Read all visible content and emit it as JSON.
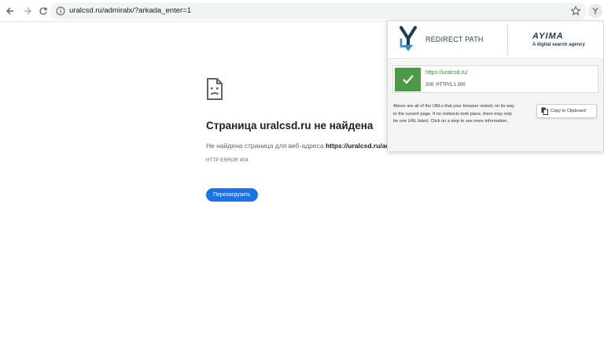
{
  "browser": {
    "url": "uralcsd.ru/admiralx/?arkada_enter=1"
  },
  "error_page": {
    "title": "Страница uralcsd.ru не найдена",
    "description_prefix": "Не найдена страница для веб-адреса ",
    "description_url": "https://uralcsd.ru/adi",
    "error_code": "HTTP ERROR 404",
    "reload_label": "Перезагрузить"
  },
  "popup": {
    "brand_title": "REDIRECT PATH",
    "partner_logo": "AYIMA",
    "partner_tagline": "A digital search agency",
    "result_url": "https://uralcsd.ru/",
    "result_status": "200: HTTP/1.1 200",
    "help_text": "Above are all of the URLs that your browser visited, on its way to the current page. If no redirects took place, there may only be one URL listed. Click on a step to see more information.",
    "copy_label": "Copy to Clipboard"
  },
  "colors": {
    "accent_blue": "#1a73e8",
    "success_green": "#4a9a46",
    "brand_navy": "#1f3d4f"
  }
}
